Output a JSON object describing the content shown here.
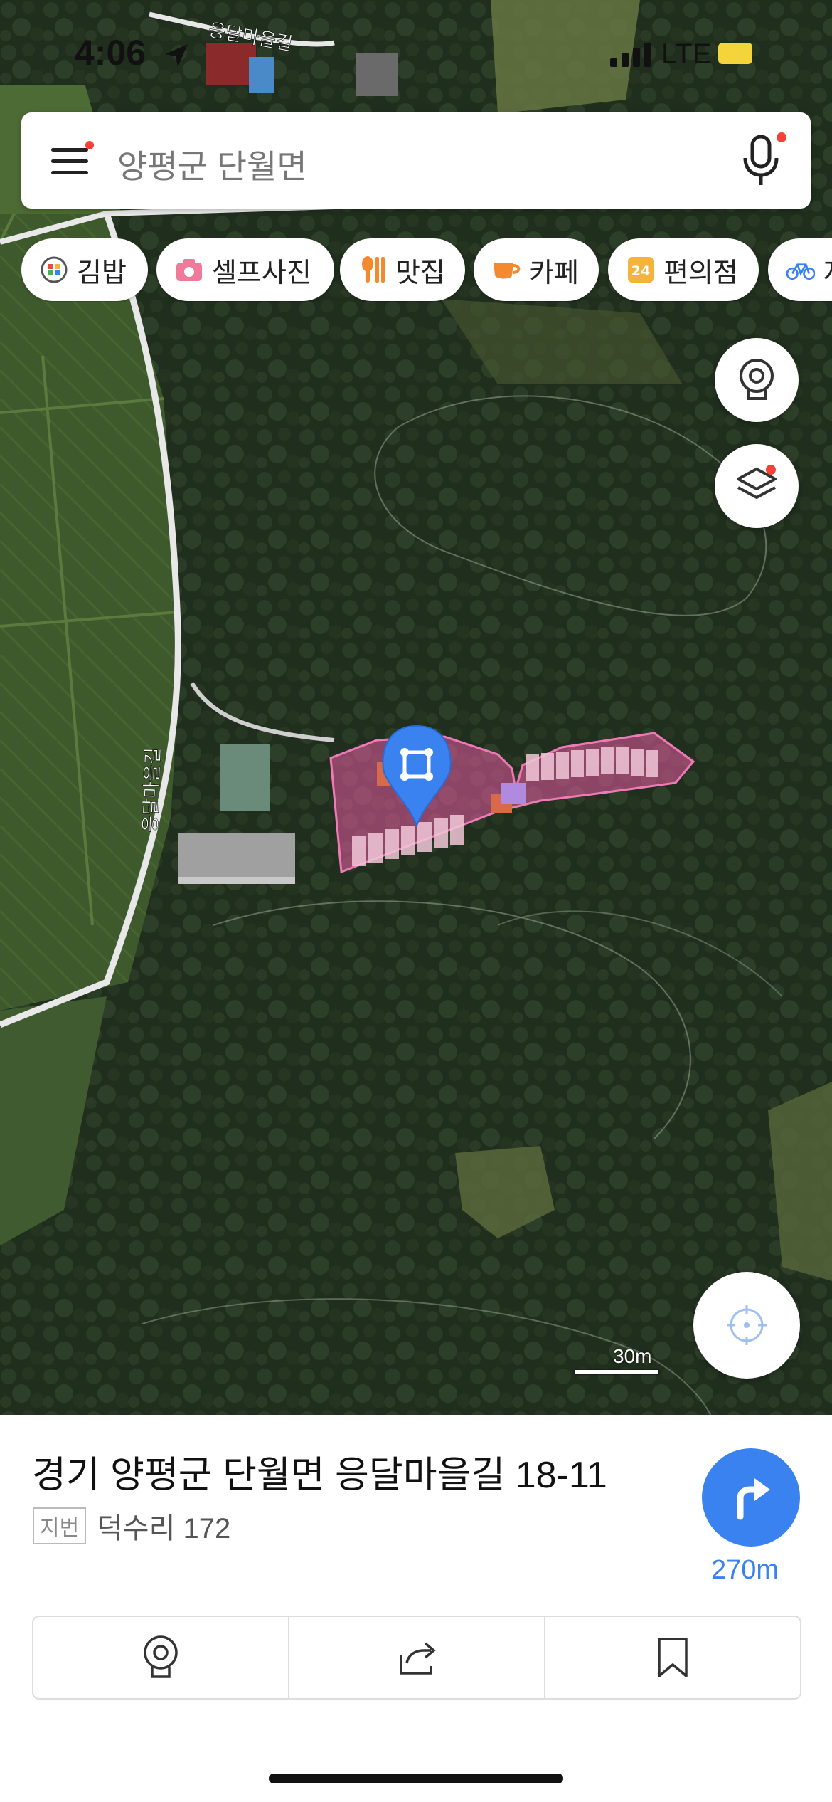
{
  "status_bar": {
    "time": "4:06",
    "network": "LTE",
    "battery_color": "#f5d33a"
  },
  "search": {
    "text": "양평군 단월면"
  },
  "chips": [
    {
      "label": "김밥",
      "icon": "kimbap-icon"
    },
    {
      "label": "셀프사진",
      "icon": "camera-icon"
    },
    {
      "label": "맛집",
      "icon": "restaurant-icon"
    },
    {
      "label": "카페",
      "icon": "cafe-icon"
    },
    {
      "label": "편의점",
      "icon": "convenience-store-icon"
    },
    {
      "label": "자",
      "icon": "bicycle-icon"
    }
  ],
  "map": {
    "road_labels": [
      "응달마을길",
      "응달마을길"
    ],
    "scale_label": "30m",
    "accent": "#3b82f1",
    "parcel_color": "#e85aa0"
  },
  "place": {
    "address": "경기 양평군 단월면 응달마을길 18-11",
    "jibun_tag": "지번",
    "jibun": "덕수리 172",
    "distance": "270m"
  },
  "actions": [
    {
      "icon": "street-view-icon"
    },
    {
      "icon": "share-icon"
    },
    {
      "icon": "bookmark-icon"
    }
  ]
}
